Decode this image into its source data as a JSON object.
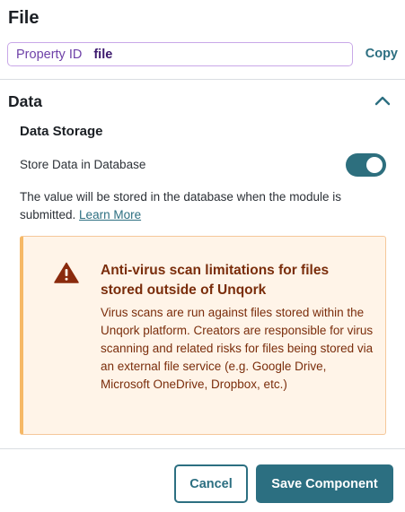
{
  "panel": {
    "title": "File"
  },
  "property": {
    "label": "Property ID",
    "value": "file",
    "copy_label": "Copy"
  },
  "section": {
    "title": "Data",
    "expanded": true,
    "subtitle": "Data Storage",
    "store_label": "Store Data in Database",
    "store_enabled": true,
    "help_text": "The value will be stored in the database when the module is submitted.",
    "learn_more": "Learn More"
  },
  "alert": {
    "icon": "warning-triangle-icon",
    "title": "Anti-virus scan limitations for files stored outside of Unqork",
    "body": "Virus scans are run against files stored within the Unqork platform. Creators are responsible for virus scanning and related risks for files being stored via an external file service (e.g. Google Drive, Microsoft OneDrive, Dropbox, etc.)"
  },
  "footer": {
    "cancel_label": "Cancel",
    "save_label": "Save Component"
  },
  "colors": {
    "accent": "#2c6f81",
    "alert_text": "#7a2d0b",
    "alert_bg": "#fff4e8",
    "property_border": "#c9a8e8"
  }
}
